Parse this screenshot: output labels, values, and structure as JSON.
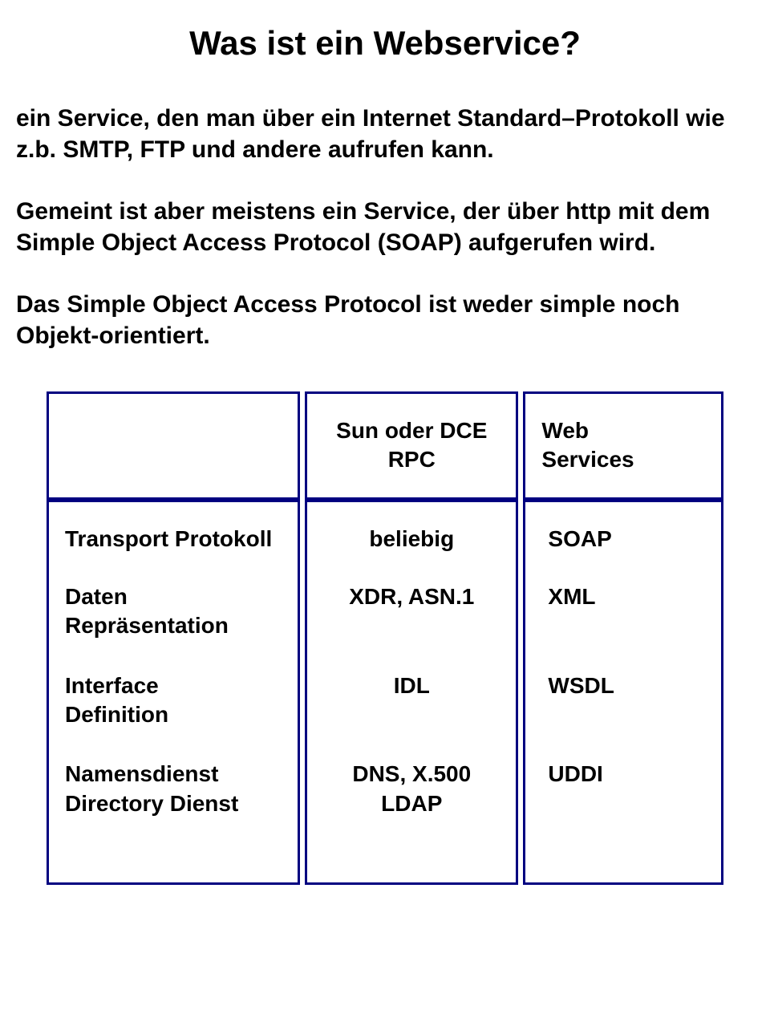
{
  "title": "Was ist ein Webservice?",
  "paragraphs": {
    "p1": "ein Service, den man über ein Internet Standard–Protokoll wie z.b. SMTP, FTP und andere aufrufen kann.",
    "p2": "Gemeint ist aber meistens ein Service, der über http mit dem Simple Object Access Protocol (SOAP) aufgerufen wird.",
    "p3": "Das Simple Object Access Protocol ist weder simple noch Objekt-orientiert."
  },
  "table": {
    "header": {
      "col1": "",
      "col2_line1": "Sun oder DCE",
      "col2_line2": "RPC",
      "col3_line1": "Web",
      "col3_line2": "Services"
    },
    "rows": {
      "r1_label": "Transport Protokoll",
      "r1_c2": "beliebig",
      "r1_c3": "SOAP",
      "r2_label_line1": "Daten",
      "r2_label_line2": "Repräsentation",
      "r2_c2": "XDR, ASN.1",
      "r2_c3": "XML",
      "r3_label_line1": "Interface",
      "r3_label_line2": "Definition",
      "r3_c2": "IDL",
      "r3_c3": "WSDL",
      "r4_label_line1": "Namensdienst",
      "r4_label_line2": "Directory Dienst",
      "r4_c2_line1": "DNS, X.500",
      "r4_c2_line2": "LDAP",
      "r4_c3": "UDDI"
    }
  }
}
